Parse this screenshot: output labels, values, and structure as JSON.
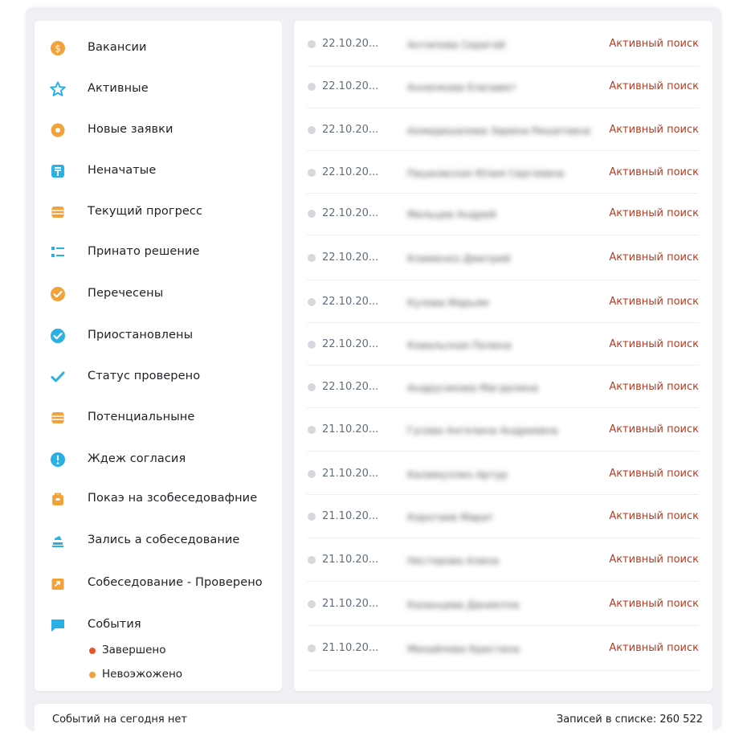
{
  "colors": {
    "orange": "#f2a23a",
    "blue": "#29b0e4",
    "status_red": "#b13c24",
    "dot_grey": "#d5d9de"
  },
  "sidebar": {
    "items": [
      {
        "label": "Вакансии",
        "icon": "coin-icon",
        "color": "#f2a23a"
      },
      {
        "label": "Активные",
        "icon": "star-icon",
        "color": "#29b0e4"
      },
      {
        "label": "Новые заявки",
        "icon": "circle-dot-icon",
        "color": "#f2a23a"
      },
      {
        "label": "Неначатые",
        "icon": "tenge-icon",
        "color": "#29b0e4"
      },
      {
        "label": "Текущий прогресс",
        "icon": "database-icon",
        "color": "#f2a23a"
      },
      {
        "label": "Принато решение",
        "icon": "list-icon",
        "color": "#29b0e4"
      },
      {
        "label": "Перечесены",
        "icon": "check-circle-icon",
        "color": "#f2a23a"
      },
      {
        "label": "Приостановлены",
        "icon": "check-badge-icon",
        "color": "#29b0e4"
      },
      {
        "label": "Статус проверено",
        "icon": "checkmark-icon",
        "color": "#29b0e4"
      },
      {
        "label": "Потенциальныне",
        "icon": "database-icon",
        "color": "#f2a23a"
      },
      {
        "label": "Ждеж согласия",
        "icon": "alert-circle-icon",
        "color": "#29b0e4"
      },
      {
        "label": "Покаэ на зсобеседовафние",
        "icon": "bag-icon",
        "color": "#f2a23a"
      },
      {
        "label": "Зались а собеседование",
        "icon": "stack-icon",
        "color": "#29b0e4"
      },
      {
        "label": "Собеседование - Проверено",
        "icon": "export-icon",
        "color": "#f2a23a"
      },
      {
        "label": "События",
        "icon": "chat-icon",
        "color": "#29b0e4"
      }
    ],
    "sub_items": [
      {
        "label": "Завершено",
        "color": "#e8552b"
      },
      {
        "label": "Невоэжожено",
        "color": "#f2a23a"
      }
    ]
  },
  "list": {
    "rows": [
      {
        "date": "22.10.20...",
        "name": "Антипова Серигей",
        "status": "Активный поиск"
      },
      {
        "date": "22.10.20...",
        "name": "Анненкова Елизавет",
        "status": "Активный поиск"
      },
      {
        "date": "22.10.20...",
        "name": "Ахмадишалова Зарина Ришатовна",
        "status": "Активный поиск"
      },
      {
        "date": "22.10.20...",
        "name": "Пашковская Юлия Сергеевна",
        "status": "Активный поиск"
      },
      {
        "date": "22.10.20...",
        "name": "Мальцев Андрей",
        "status": "Активный поиск"
      },
      {
        "date": "22.10.20...",
        "name": "Клименко Дмитрий",
        "status": "Активный поиск"
      },
      {
        "date": "22.10.20...",
        "name": "Кулова Марьям",
        "status": "Активный поиск"
      },
      {
        "date": "22.10.20...",
        "name": "Ковальская Полина",
        "status": "Активный поиск"
      },
      {
        "date": "22.10.20...",
        "name": "Андрусикова Магдалина",
        "status": "Активный поиск"
      },
      {
        "date": "21.10.20...",
        "name": "Гусева Ангелина Андреевна",
        "status": "Активный поиск"
      },
      {
        "date": "21.10.20...",
        "name": "Калимуллин Артур",
        "status": "Активный поиск"
      },
      {
        "date": "21.10.20...",
        "name": "Коротаев Марат",
        "status": "Активный поиск"
      },
      {
        "date": "21.10.20...",
        "name": "Нестерова Алина",
        "status": "Активный поиск"
      },
      {
        "date": "21.10.20...",
        "name": "Казанцева Даниелла",
        "status": "Активный поиск"
      },
      {
        "date": "21.10.20...",
        "name": "Михайлова Кристина",
        "status": "Активный поиск"
      }
    ]
  },
  "footer": {
    "left": "Событий на сегодня нет",
    "right": "Записей в списке: 260 522"
  }
}
